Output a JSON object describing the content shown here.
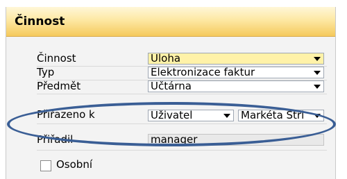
{
  "window": {
    "title": "Činnost"
  },
  "form": {
    "activity": {
      "label": "Činnost",
      "value": "Úloha"
    },
    "type": {
      "label": "Typ",
      "value": "Elektronizace faktur"
    },
    "subject": {
      "label": "Předmět",
      "value": "Účtárna"
    },
    "assigned_to": {
      "label": "Přiřazeno k",
      "type_value": "Uživatel",
      "user_value": "Markéta Stri"
    },
    "assigned_by": {
      "label": "Přiřadil",
      "value": "manager"
    },
    "personal": {
      "label": "Osobní",
      "checked": false
    }
  },
  "colors": {
    "title_gradient": "#f5c95c",
    "mandatory_field": "#fff2a8",
    "highlight_ellipse": "#3a5e95"
  }
}
